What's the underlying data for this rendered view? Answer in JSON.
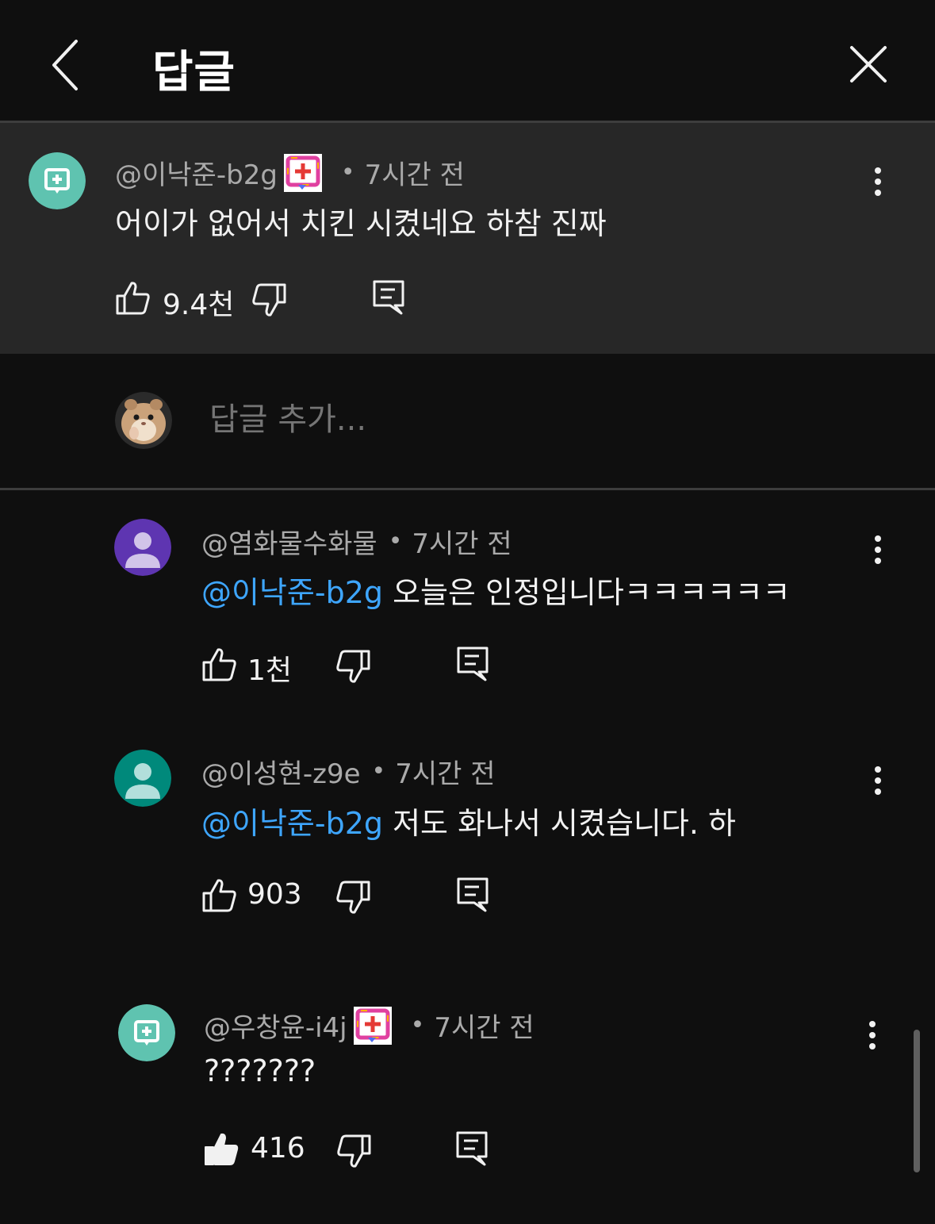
{
  "header": {
    "title": "답글",
    "back_icon": "chevron-left-icon",
    "close_icon": "close-icon"
  },
  "parent_comment": {
    "author": "@이낙준-b2g",
    "time": "7시간 전",
    "text": "어이가 없어서 치킨 시켰네요 하참 진짜",
    "likes": "9.4천",
    "avatar_color": "#5fc3b0"
  },
  "reply_box": {
    "placeholder": "답글 추가..."
  },
  "replies": [
    {
      "author": "@염화물수화물",
      "time": "7시간 전",
      "mention": "@이낙준-b2g",
      "text": " 오늘은 인정입니다ㅋㅋㅋㅋㅋㅋ",
      "likes": "1천",
      "avatar_color": "#5e35b1"
    },
    {
      "author": "@이성현-z9e",
      "time": "7시간 전",
      "mention": "@이낙준-b2g",
      "text": " 저도 화나서 시켰습니다. 하",
      "likes": "903",
      "avatar_color": "#00897b"
    },
    {
      "author": "@우창윤-i4j",
      "time": "7시간 전",
      "mention": "",
      "text": "???????",
      "likes": "416",
      "liked": true,
      "avatar_color": "#5fc3b0"
    }
  ],
  "separator": "•"
}
